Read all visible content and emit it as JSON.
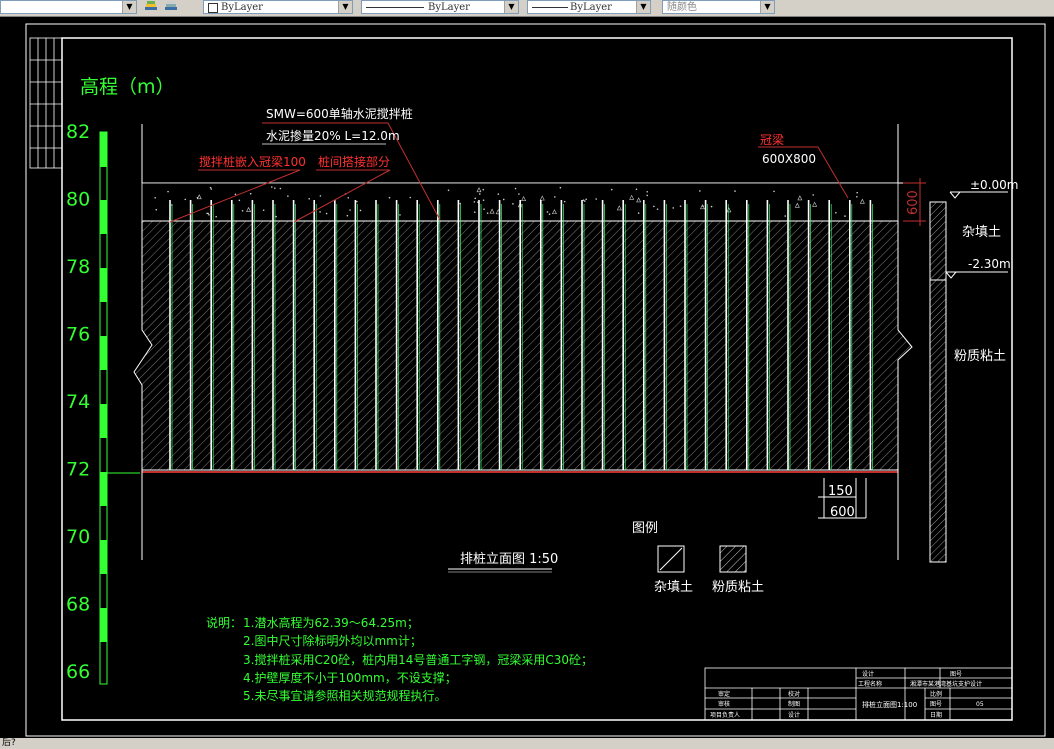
{
  "toolbar": {
    "linetype_dropdown": "ByLayer",
    "linetype2_dropdown": "ByLayer",
    "lineweight_dropdown": "ByLayer",
    "color_dropdown": "随颜色"
  },
  "status": {
    "command_text": "后?"
  },
  "drawing": {
    "elevation_label": "高程（m）",
    "elevation_ticks": [
      "82",
      "80",
      "78",
      "76",
      "74",
      "72",
      "70",
      "68",
      "66"
    ],
    "callouts": {
      "smw_pile": "SMW=600单轴水泥搅拌桩",
      "cement_ratio": "水泥掺量20% L=12.0m",
      "pile_into_beam": "搅拌桩嵌入冠梁100",
      "pile_overlap": "桩间搭接部分",
      "crown_beam": "冠梁",
      "crown_beam_size": "600X800"
    },
    "dims": {
      "beam_height": "600",
      "pile_spacing": "150",
      "pile_dia": "600"
    },
    "soil_levels": {
      "top": "±0.00m",
      "layer1_bottom": "-2.30m"
    },
    "soil_layers": [
      "杂填土",
      "粉质粘土"
    ],
    "figure_title": "排桩立面图 1:50",
    "legend": {
      "title": "图例",
      "items": [
        "杂填土",
        "粉质粘土"
      ]
    },
    "notes": {
      "heading": "说明：",
      "lines": [
        "1.潜水高程为62.39～64.25m；",
        "2.图中尺寸除标明外均以mm计；",
        "3.搅拌桩采用C20砼，桩内用14号普通工字钢，冠梁采用C30砼；",
        "4.护壁厚度不小于100mm，不设支撑；",
        "5.未尽事宜请参照相关规范规程执行。"
      ]
    },
    "title_block": {
      "project_label": "工程名称",
      "project_name": "湘潭市某港湾基坑支护设计",
      "design_label": "设计",
      "number_label": "图号",
      "number": "05",
      "scale_text": "排桩立面图1:100",
      "date_label": "日期",
      "approve_label": "审定",
      "review_label": "审核",
      "draw_label": "制图",
      "lead_label": "项目负责人",
      "check_label": "校对",
      "sheet_label": "设计",
      "unit_label": "比例"
    }
  }
}
